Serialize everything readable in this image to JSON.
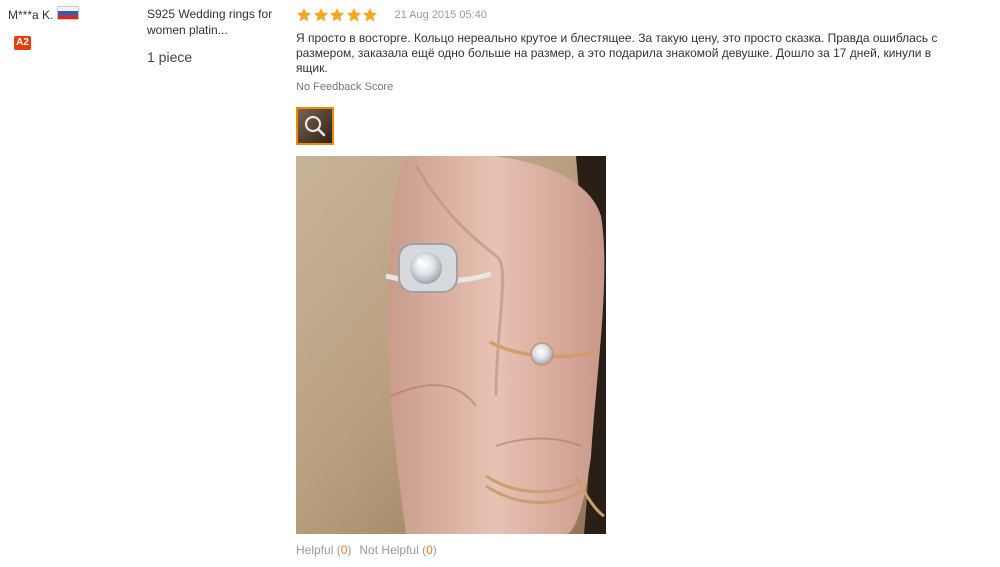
{
  "review": {
    "user": {
      "name": "M***a K.",
      "flag_icon": "russia-flag-icon",
      "level_badge": "A2"
    },
    "product": {
      "title_line1": "S925 Wedding rings for",
      "title_line2": "women platin...",
      "quantity": "1 piece"
    },
    "rating": {
      "stars": 5,
      "max": 5,
      "star_color": "#f5a623"
    },
    "date": "21 Aug 2015 05:40",
    "text_lines": [
      "Я просто в восторге. Кольцо нереально крутое и блестящее. За такую цену, это просто сказка. Правда ошиблась с",
      "размером, заказала ещё одно больше на размер, а это подарила знакомой девушке. Дошло за 17 дней, кинули в",
      "ящик."
    ],
    "feedback_score": "No Feedback Score",
    "thumbnail_icon": "magnifier-icon",
    "helpful": {
      "helpful_label": "Helpful",
      "helpful_open": "(",
      "helpful_count": "0",
      "helpful_close": ")",
      "not_helpful_label": "Not Helpful",
      "not_helpful_open": "(",
      "not_helpful_count": "0",
      "not_helpful_close": ")"
    }
  }
}
